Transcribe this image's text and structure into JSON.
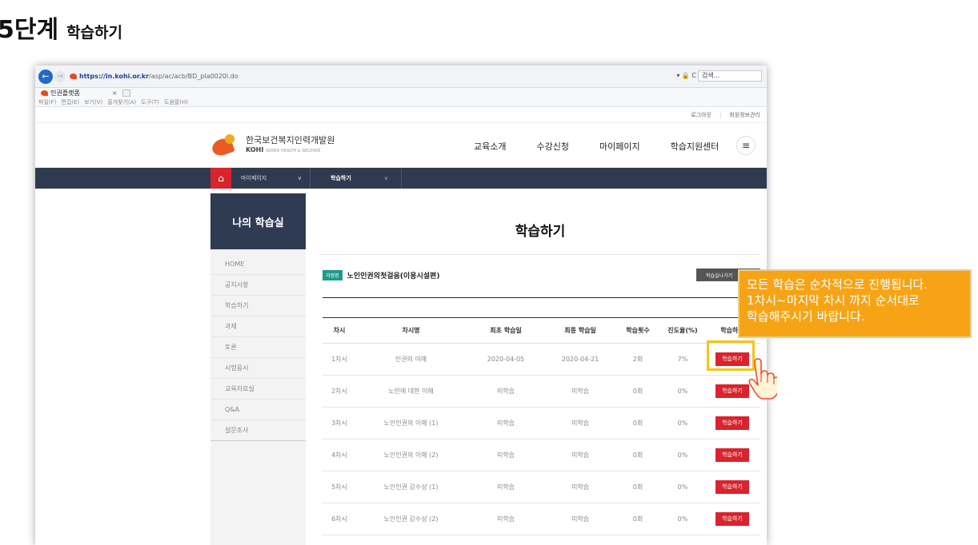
{
  "step": {
    "number": "5단계",
    "label": "학습하기"
  },
  "browser": {
    "url_host": "https://in.kohi.or.kr",
    "url_path": "/asp/ac/acb/BD_pla0020l.do",
    "right_icons": "▾ 🔒 C",
    "search_placeholder": "검색...",
    "tab_title": "인권플랫폼",
    "tab_close": "×",
    "menu": [
      "파일(F)",
      "편집(E)",
      "보기(V)",
      "즐겨찾기(A)",
      "도구(T)",
      "도움말(H)"
    ]
  },
  "util": {
    "logout": "로그아웃",
    "sep": "|",
    "member": "회원정보관리"
  },
  "site": {
    "org_name": "한국보건복지인력개발원",
    "org_en": "KOHI",
    "org_en_sub": "KOREA HEALTH & WELFARE",
    "gnb": [
      "교육소개",
      "수강신청",
      "마이페이지",
      "학습지원센터"
    ],
    "hamburger": "≡"
  },
  "subnav": {
    "home": "⌂",
    "level1": "마이페이지",
    "level2": "학습하기",
    "chev": "∨"
  },
  "sidebar": {
    "title": "나의 학습실",
    "items": [
      "HOME",
      "공지사항",
      "학습하기",
      "과제",
      "토론",
      "시험응시",
      "교육자료실",
      "Q&A",
      "설문조사"
    ]
  },
  "main": {
    "title": "학습하기",
    "course_badge": "과정명",
    "course_name": "노인인권의첫걸음(이용시설편)",
    "exit_button": "학습실나가기"
  },
  "table": {
    "headers": [
      "차시",
      "차시명",
      "최초 학습일",
      "최종 학습일",
      "학습횟수",
      "진도율(%)",
      "학습하기"
    ],
    "rows": [
      {
        "no": "1차시",
        "name": "인권의 이해",
        "first": "2020-04-05",
        "last": "2020-04-21",
        "count": "2회",
        "progress": "7%",
        "action": "학습하기"
      },
      {
        "no": "2차시",
        "name": "노인에 대한 이해",
        "first": "미학습",
        "last": "미학습",
        "count": "0회",
        "progress": "0%",
        "action": "학습하기"
      },
      {
        "no": "3차시",
        "name": "노인인권의 이해 (1)",
        "first": "미학습",
        "last": "미학습",
        "count": "0회",
        "progress": "0%",
        "action": "학습하기"
      },
      {
        "no": "4차시",
        "name": "노인인권의 이해 (2)",
        "first": "미학습",
        "last": "미학습",
        "count": "0회",
        "progress": "0%",
        "action": "학습하기"
      },
      {
        "no": "5차시",
        "name": "노인인권 감수성 (1)",
        "first": "미학습",
        "last": "미학습",
        "count": "0회",
        "progress": "0%",
        "action": "학습하기"
      },
      {
        "no": "6차시",
        "name": "노인인권 감수성 (2)",
        "first": "미학습",
        "last": "미학습",
        "count": "0회",
        "progress": "0%",
        "action": "학습하기"
      }
    ]
  },
  "callout": {
    "lines": [
      "모든 학습은 순차적으로 진행됩니다.",
      "1차시~마지막 차시 까지 순서대로",
      "학습해주시기 바랍니다."
    ]
  },
  "colors": {
    "accent_red": "#d9232d",
    "navy": "#2e3a4f",
    "callout": "#f6a415",
    "highlight": "#f5c518"
  }
}
